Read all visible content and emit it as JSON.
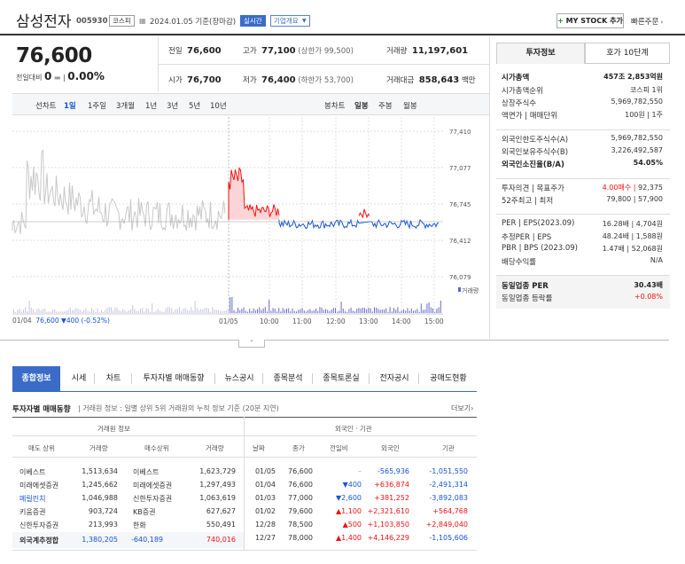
{
  "header": {
    "name": "삼성전자",
    "code": "005930",
    "market": "코스피",
    "date": "2024.01.05 기준(장마감)",
    "realtime": "실시간",
    "company_info": "기업개요",
    "mystock": "MY STOCK 추가",
    "quick_order": "빠른주문"
  },
  "quote": {
    "price": "76,600",
    "change_label": "전일대비",
    "change": "0",
    "change_pct": "0.00%",
    "prev_label": "전일",
    "prev": "76,600",
    "high_label": "고가",
    "high": "77,100",
    "upper_limit": "(상한가 99,500)",
    "volume_label": "거래량",
    "volume": "11,197,601",
    "open_label": "시가",
    "open": "76,700",
    "low_label": "저가",
    "low": "76,400",
    "lower_limit": "(하한가 53,700)",
    "amount_label": "거래대금",
    "amount": "858,643",
    "amount_unit": "백만"
  },
  "right_tabs": [
    "투자정보",
    "호가 10단계"
  ],
  "invest_info": [
    {
      "label": "시가총액",
      "value": "457조 2,853억원",
      "bold": true
    },
    {
      "label": "시가총액순위",
      "value": "코스피 1위"
    },
    {
      "label": "상장주식수",
      "value": "5,969,782,550"
    },
    {
      "label": "액면가 | 매매단위",
      "value": "100원 | 1주"
    },
    {
      "label": "외국인한도주식수(A)",
      "value": "5,969,782,550"
    },
    {
      "label": "외국인보유주식수(B)",
      "value": "3,226,492,587"
    },
    {
      "label": "외국인소진율(B/A)",
      "value": "54.05%",
      "bold": true
    },
    {
      "label": "투자의견 | 목표주가",
      "value_red": "4.00매수",
      "value": "92,375"
    },
    {
      "label": "52주최고 | 최저",
      "value": "79,800 | 57,900"
    },
    {
      "label": "PER | EPS(2023.09)",
      "value": "16.28배 | 4,704원"
    },
    {
      "label": "추정PER | EPS",
      "value": "48.24배 | 1,588원"
    },
    {
      "label": "PBR | BPS (2023.09)",
      "value": "1.47배 | 52,068원"
    },
    {
      "label": "배당수익률",
      "value": "N/A"
    },
    {
      "label": "동일업종 PER",
      "value": "30.43배",
      "bold": true
    },
    {
      "label": "동일업종 등락률",
      "value": "+0.08%",
      "red": true
    }
  ],
  "chart_bar": {
    "line_label": "선차트",
    "periods": [
      "1일",
      "1주일",
      "3개월",
      "1년",
      "3년",
      "5년",
      "10년"
    ],
    "candle_label": "봉차트",
    "candle": [
      "일봉",
      "주봉",
      "월봉"
    ]
  },
  "chart": {
    "y_ticks": [
      "77,410",
      "77,077",
      "76,745",
      "76,412",
      "76,079"
    ],
    "x_ticks": [
      "01/05",
      "10:00",
      "11:00",
      "12:00",
      "13:00",
      "14:00",
      "15:00"
    ],
    "volume_label": "거래량",
    "prev_note_date": "01/04",
    "prev_note_price": "76,600",
    "prev_note_change": "▼400",
    "prev_note_pct": "(-0.52%)"
  },
  "chart_data": {
    "type": "line",
    "ylim": [
      76079,
      77410
    ],
    "yticks": [
      77410,
      77077,
      76745,
      76412,
      76079
    ],
    "baseline": 76600
  },
  "nav_tabs": [
    "종합정보",
    "시세",
    "차트",
    "투자자별 매매동향",
    "뉴스공시",
    "종목분석",
    "종목토론실",
    "전자공시",
    "공매도현황"
  ],
  "trade_section": {
    "title": "투자자별 매매동향",
    "desc": "거래원 정보 : 일별 상위 5위 거래원의 누적 정보 기준 (20분 지연)",
    "more": "더보기",
    "left_header": "거래원 정보",
    "right_header": "외국인 · 기관",
    "cols_left": [
      "매도 상위",
      "거래량",
      "매수상위",
      "거래량"
    ],
    "cols_right": [
      "날짜",
      "종가",
      "전일비",
      "외국인",
      "기관"
    ],
    "brokers": [
      [
        "이베스트",
        "1,513,634",
        "이베스트",
        "1,623,729"
      ],
      [
        "미래에셋증권",
        "1,245,662",
        "미래에셋증권",
        "1,297,493"
      ],
      [
        "메릴린치",
        "1,046,988",
        "신한투자증권",
        "1,063,619"
      ],
      [
        "키움증권",
        "903,724",
        "KB증권",
        "627,627"
      ],
      [
        "신한투자증권",
        "213,993",
        "한화",
        "550,491"
      ]
    ],
    "foreign_est": [
      "외국계추정합",
      "1,380,205",
      "-640,189",
      "740,016"
    ],
    "daily": [
      [
        "01/05",
        "76,600",
        "",
        "-565,936",
        "-1,051,550"
      ],
      [
        "01/04",
        "76,600",
        "▼400",
        "+636,874",
        "-2,491,314"
      ],
      [
        "01/03",
        "77,000",
        "▼2,600",
        "+381,252",
        "-3,892,083"
      ],
      [
        "01/02",
        "79,600",
        "▲1,100",
        "+2,321,610",
        "+564,768"
      ],
      [
        "12/28",
        "78,500",
        "▲500",
        "+1,103,850",
        "+2,849,040"
      ],
      [
        "12/27",
        "78,000",
        "▲1,400",
        "+4,146,229",
        "-1,105,606"
      ]
    ]
  }
}
